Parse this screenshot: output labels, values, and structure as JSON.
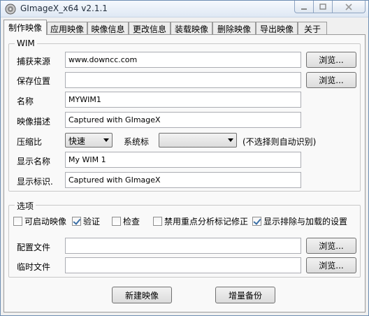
{
  "window": {
    "title": "GImageX_x64 v2.1.1"
  },
  "tabs": [
    {
      "label": "制作映像",
      "active": true
    },
    {
      "label": "应用映像"
    },
    {
      "label": "映像信息"
    },
    {
      "label": "更改信息"
    },
    {
      "label": "装载映像"
    },
    {
      "label": "删除映像"
    },
    {
      "label": "导出映像"
    },
    {
      "label": "关于"
    }
  ],
  "wim": {
    "legend": "WIM",
    "source": {
      "label": "捕获来源",
      "value": "www.downcc.com",
      "browse": "浏览..."
    },
    "save": {
      "label": "保存位置",
      "value": "",
      "browse": "浏览..."
    },
    "name": {
      "label": "名称",
      "value": "MYWIM1"
    },
    "description": {
      "label": "映像描述",
      "value": "Captured with GImageX"
    },
    "compression": {
      "label": "压缩比",
      "value": "快速"
    },
    "flags": {
      "label": "系统标",
      "value": "",
      "hint": "(不选择则自动识别)"
    },
    "display_name": {
      "label": "显示名称",
      "value": "My WIM 1"
    },
    "display_desc": {
      "label": "显示标识.",
      "value": "Captured with GImageX"
    }
  },
  "options": {
    "legend": "选项",
    "checks": [
      {
        "label": "可启动映像",
        "checked": false
      },
      {
        "label": "验证",
        "checked": true
      },
      {
        "label": "检查",
        "checked": false
      },
      {
        "label": "禁用重点分析标记修正",
        "checked": false
      },
      {
        "label": "显示排除与加载的设置",
        "checked": true
      }
    ],
    "config": {
      "label": "配置文件",
      "value": "",
      "browse": "浏览..."
    },
    "temp": {
      "label": "临时文件",
      "value": "",
      "browse": "浏览..."
    }
  },
  "actions": {
    "create": "新建映像",
    "append": "增量备份"
  },
  "icons": {
    "app": "gimagex-disc-icon",
    "minimize": "minimize-icon",
    "maximize": "maximize-icon",
    "close": "close-icon"
  }
}
